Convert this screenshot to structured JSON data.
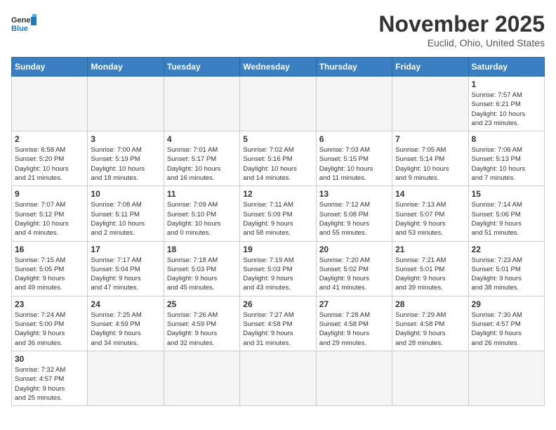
{
  "header": {
    "logo_general": "General",
    "logo_blue": "Blue",
    "month_title": "November 2025",
    "location": "Euclid, Ohio, United States"
  },
  "days_of_week": [
    "Sunday",
    "Monday",
    "Tuesday",
    "Wednesday",
    "Thursday",
    "Friday",
    "Saturday"
  ],
  "weeks": [
    [
      {
        "day": "",
        "info": ""
      },
      {
        "day": "",
        "info": ""
      },
      {
        "day": "",
        "info": ""
      },
      {
        "day": "",
        "info": ""
      },
      {
        "day": "",
        "info": ""
      },
      {
        "day": "",
        "info": ""
      },
      {
        "day": "1",
        "info": "Sunrise: 7:57 AM\nSunset: 6:21 PM\nDaylight: 10 hours\nand 23 minutes."
      }
    ],
    [
      {
        "day": "2",
        "info": "Sunrise: 6:58 AM\nSunset: 5:20 PM\nDaylight: 10 hours\nand 21 minutes."
      },
      {
        "day": "3",
        "info": "Sunrise: 7:00 AM\nSunset: 5:19 PM\nDaylight: 10 hours\nand 18 minutes."
      },
      {
        "day": "4",
        "info": "Sunrise: 7:01 AM\nSunset: 5:17 PM\nDaylight: 10 hours\nand 16 minutes."
      },
      {
        "day": "5",
        "info": "Sunrise: 7:02 AM\nSunset: 5:16 PM\nDaylight: 10 hours\nand 14 minutes."
      },
      {
        "day": "6",
        "info": "Sunrise: 7:03 AM\nSunset: 5:15 PM\nDaylight: 10 hours\nand 11 minutes."
      },
      {
        "day": "7",
        "info": "Sunrise: 7:05 AM\nSunset: 5:14 PM\nDaylight: 10 hours\nand 9 minutes."
      },
      {
        "day": "8",
        "info": "Sunrise: 7:06 AM\nSunset: 5:13 PM\nDaylight: 10 hours\nand 7 minutes."
      }
    ],
    [
      {
        "day": "9",
        "info": "Sunrise: 7:07 AM\nSunset: 5:12 PM\nDaylight: 10 hours\nand 4 minutes."
      },
      {
        "day": "10",
        "info": "Sunrise: 7:08 AM\nSunset: 5:11 PM\nDaylight: 10 hours\nand 2 minutes."
      },
      {
        "day": "11",
        "info": "Sunrise: 7:09 AM\nSunset: 5:10 PM\nDaylight: 10 hours\nand 0 minutes."
      },
      {
        "day": "12",
        "info": "Sunrise: 7:11 AM\nSunset: 5:09 PM\nDaylight: 9 hours\nand 58 minutes."
      },
      {
        "day": "13",
        "info": "Sunrise: 7:12 AM\nSunset: 5:08 PM\nDaylight: 9 hours\nand 55 minutes."
      },
      {
        "day": "14",
        "info": "Sunrise: 7:13 AM\nSunset: 5:07 PM\nDaylight: 9 hours\nand 53 minutes."
      },
      {
        "day": "15",
        "info": "Sunrise: 7:14 AM\nSunset: 5:06 PM\nDaylight: 9 hours\nand 51 minutes."
      }
    ],
    [
      {
        "day": "16",
        "info": "Sunrise: 7:15 AM\nSunset: 5:05 PM\nDaylight: 9 hours\nand 49 minutes."
      },
      {
        "day": "17",
        "info": "Sunrise: 7:17 AM\nSunset: 5:04 PM\nDaylight: 9 hours\nand 47 minutes."
      },
      {
        "day": "18",
        "info": "Sunrise: 7:18 AM\nSunset: 5:03 PM\nDaylight: 9 hours\nand 45 minutes."
      },
      {
        "day": "19",
        "info": "Sunrise: 7:19 AM\nSunset: 5:03 PM\nDaylight: 9 hours\nand 43 minutes."
      },
      {
        "day": "20",
        "info": "Sunrise: 7:20 AM\nSunset: 5:02 PM\nDaylight: 9 hours\nand 41 minutes."
      },
      {
        "day": "21",
        "info": "Sunrise: 7:21 AM\nSunset: 5:01 PM\nDaylight: 9 hours\nand 39 minutes."
      },
      {
        "day": "22",
        "info": "Sunrise: 7:23 AM\nSunset: 5:01 PM\nDaylight: 9 hours\nand 38 minutes."
      }
    ],
    [
      {
        "day": "23",
        "info": "Sunrise: 7:24 AM\nSunset: 5:00 PM\nDaylight: 9 hours\nand 36 minutes."
      },
      {
        "day": "24",
        "info": "Sunrise: 7:25 AM\nSunset: 4:59 PM\nDaylight: 9 hours\nand 34 minutes."
      },
      {
        "day": "25",
        "info": "Sunrise: 7:26 AM\nSunset: 4:59 PM\nDaylight: 9 hours\nand 32 minutes."
      },
      {
        "day": "26",
        "info": "Sunrise: 7:27 AM\nSunset: 4:58 PM\nDaylight: 9 hours\nand 31 minutes."
      },
      {
        "day": "27",
        "info": "Sunrise: 7:28 AM\nSunset: 4:58 PM\nDaylight: 9 hours\nand 29 minutes."
      },
      {
        "day": "28",
        "info": "Sunrise: 7:29 AM\nSunset: 4:58 PM\nDaylight: 9 hours\nand 28 minutes."
      },
      {
        "day": "29",
        "info": "Sunrise: 7:30 AM\nSunset: 4:57 PM\nDaylight: 9 hours\nand 26 minutes."
      }
    ],
    [
      {
        "day": "30",
        "info": "Sunrise: 7:32 AM\nSunset: 4:57 PM\nDaylight: 9 hours\nand 25 minutes."
      },
      {
        "day": "",
        "info": ""
      },
      {
        "day": "",
        "info": ""
      },
      {
        "day": "",
        "info": ""
      },
      {
        "day": "",
        "info": ""
      },
      {
        "day": "",
        "info": ""
      },
      {
        "day": "",
        "info": ""
      }
    ]
  ]
}
